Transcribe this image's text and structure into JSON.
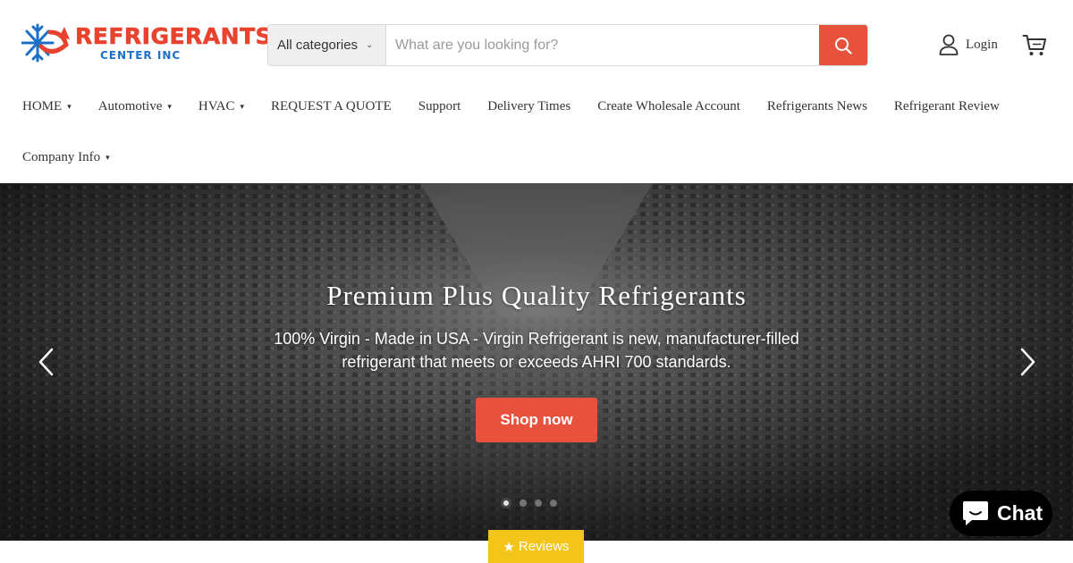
{
  "brand": {
    "logo_main": "REFRIGERANTS",
    "logo_sub": "CENTER INC",
    "accent": "#e8513b",
    "logo_blue": "#1e6fc8"
  },
  "search": {
    "category_label": "All categories",
    "placeholder": "What are you looking for?",
    "icon": "search-icon"
  },
  "account": {
    "login_label": "Login",
    "user_icon": "user-icon",
    "cart_icon": "cart-icon"
  },
  "nav": {
    "items": [
      {
        "label": "HOME",
        "has_dropdown": true
      },
      {
        "label": "Automotive",
        "has_dropdown": true
      },
      {
        "label": "HVAC",
        "has_dropdown": true
      },
      {
        "label": "REQUEST A QUOTE",
        "has_dropdown": false
      },
      {
        "label": "Support",
        "has_dropdown": false
      },
      {
        "label": "Delivery Times",
        "has_dropdown": false
      },
      {
        "label": "Create Wholesale Account",
        "has_dropdown": false
      },
      {
        "label": "Refrigerants News",
        "has_dropdown": false
      },
      {
        "label": "Refrigerant Review",
        "has_dropdown": false
      },
      {
        "label": "Company Info",
        "has_dropdown": true
      }
    ]
  },
  "hero": {
    "title": "Premium Plus Quality Refrigerants",
    "subtitle": "100% Virgin - Made in USA - Virgin Refrigerant is new, manufacturer-filled refrigerant that meets or exceeds AHRI 700 standards.",
    "button_label": "Shop now",
    "prev_icon": "chevron-left-icon",
    "next_icon": "chevron-right-icon",
    "slide_count": 4,
    "active_slide": 1
  },
  "chat": {
    "label": "Chat",
    "icon": "chat-bubble-icon"
  },
  "reviews": {
    "label": "Reviews",
    "icon": "star-icon"
  }
}
